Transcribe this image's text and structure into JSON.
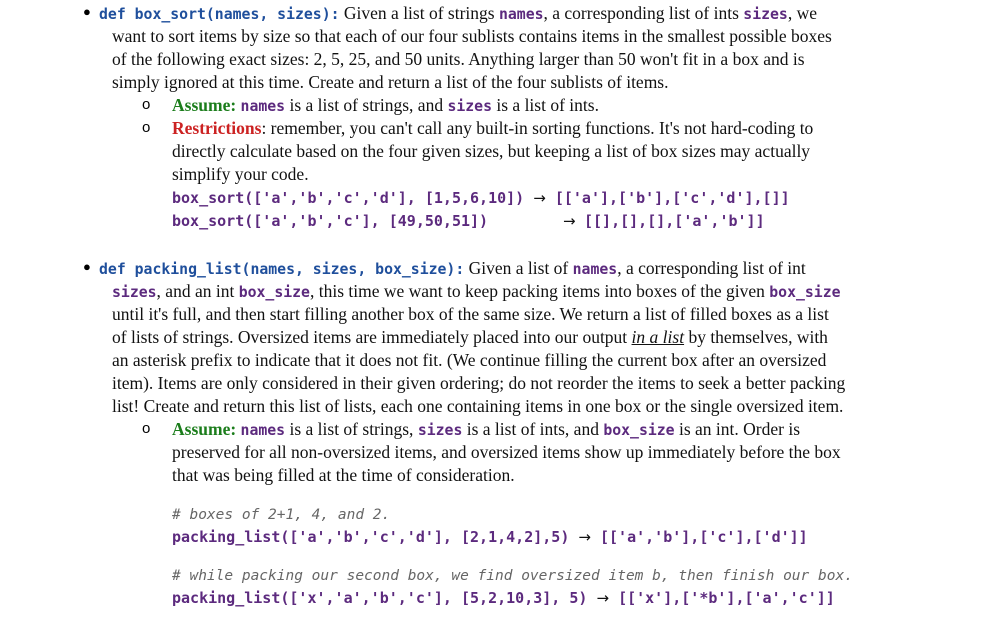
{
  "section1": {
    "signature": "def box_sort(names, sizes):",
    "desc": [
      [
        "Given a list of strings ",
        "names",
        ", a corresponding list of ints ",
        "sizes",
        ", we"
      ],
      "want to sort items by size so that each of our four sublists contains items in the smallest possible boxes",
      "of the following exact sizes: 2, 5, 25, and 50 units. Anything larger than 50 won't fit in a box and is",
      "simply ignored at this time. Create and return a list of the four sublists of items."
    ],
    "assume_label": "Assume:",
    "assume_names": "names",
    "assume_mid": " is a list of strings, and ",
    "assume_sizes": "sizes",
    "assume_end": " is a list of ints.",
    "restrict_label": "Restrictions",
    "restrict_lines": [
      ": remember, you can't call any built-in sorting functions. It's not hard-coding to",
      "directly calculate based on the four given sizes, but keeping a list of box sizes may actually",
      "simplify your code."
    ],
    "examples": [
      {
        "call": "box_sort(['a','b','c','d'], [1,5,6,10])",
        "result": "[['a'],['b'],['c','d'],[]]"
      },
      {
        "call": "box_sort(['a','b','c'], [49,50,51])",
        "result": "[[],[],[],['a','b']]"
      }
    ]
  },
  "section2": {
    "signature": "def packing_list(names, sizes, box_size):",
    "l1_a": " Given a list of ",
    "l1_names": "names",
    "l1_b": ", a corresponding list of int",
    "l2_sizes": "sizes",
    "l2_a": ", and an int ",
    "l2_box": "box_size",
    "l2_b": ", this time we want to keep packing items into boxes of the given ",
    "l2_box2": "box_size",
    "l3": "until it's full, and then start filling another box of the same size. We return a list of filled boxes as a list",
    "l4_a": "of lists of strings. Oversized items are immediately placed into our output ",
    "l4_it": "in a list",
    "l4_b": " by themselves, with",
    "l5": "an asterisk prefix to indicate that it does not fit. (We continue filling the current box after an oversized",
    "l6": "item). Items are only considered in their given ordering; do not reorder the items to seek a better packing",
    "l7": "list! Create and return this list of lists, each one containing items in one box or the single oversized item.",
    "assume_label": "Assume:",
    "a_names": "names",
    "a_1": " is a list of strings, ",
    "a_sizes": "sizes",
    "a_2": " is a list of ints, and ",
    "a_box": "box_size",
    "a_3": "  is an int. Order is",
    "a_l2": "preserved for all non-oversized items, and oversized items show up immediately before the box",
    "a_l3": "that was being filled at the time of consideration.",
    "comment1": "# boxes of 2+1, 4, and 2.",
    "call1": "packing_list(['a','b','c','d'], [2,1,4,2],5)",
    "result1": "[['a','b'],['c'],['d']]",
    "comment2": "# while packing our second box, we find oversized item b, then finish our box.",
    "call2": "packing_list(['x','a','b','c'], [5,2,10,3], 5)",
    "result2": "[['x'],['*b'],['a','c']]"
  },
  "arrow": "→"
}
